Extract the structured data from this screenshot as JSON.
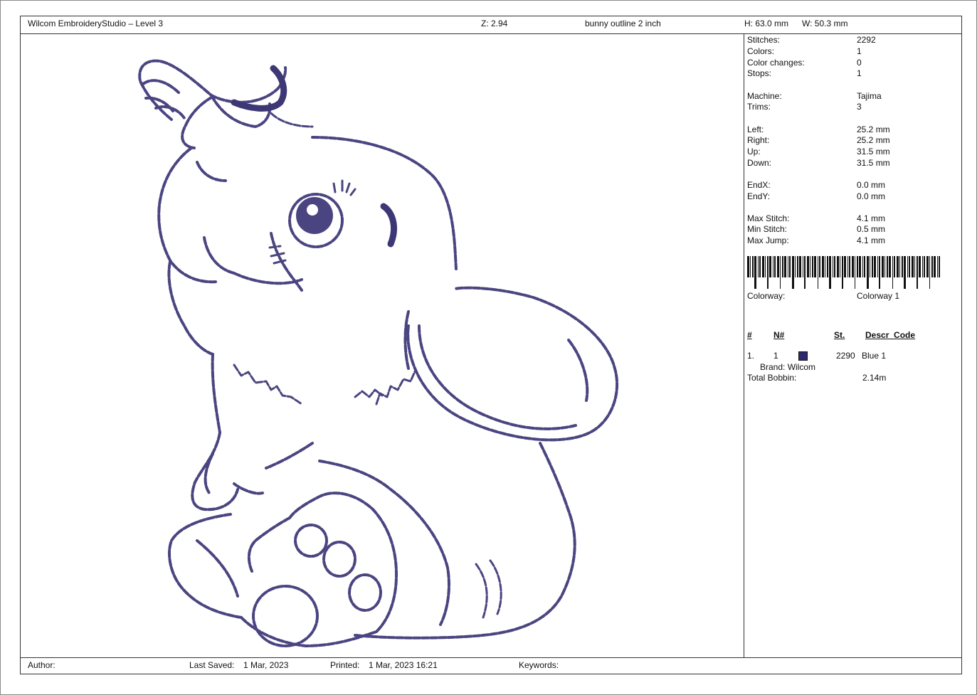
{
  "header": {
    "app": "Wilcom EmbroideryStudio – Level 3",
    "zoom": "Z: 2.94",
    "design_name": "bunny outline 2 inch",
    "height": "H: 63.0 mm",
    "width": "W: 50.3 mm"
  },
  "stats": [
    {
      "label": "Stitches:",
      "value": "2292"
    },
    {
      "label": "Colors:",
      "value": "1"
    },
    {
      "label": "Color changes:",
      "value": "0"
    },
    {
      "label": "Stops:",
      "value": "1"
    },
    {
      "label": "Machine:",
      "value": "Tajima"
    },
    {
      "label": "Trims:",
      "value": "3"
    },
    {
      "label": "Left:",
      "value": "25.2 mm"
    },
    {
      "label": "Right:",
      "value": "25.2 mm"
    },
    {
      "label": "Up:",
      "value": "31.5 mm"
    },
    {
      "label": "Down:",
      "value": "31.5 mm"
    },
    {
      "label": "EndX:",
      "value": "0.0 mm"
    },
    {
      "label": "EndY:",
      "value": "0.0 mm"
    },
    {
      "label": "Max Stitch:",
      "value": "4.1 mm"
    },
    {
      "label": "Min Stitch:",
      "value": "0.5 mm"
    },
    {
      "label": "Max Jump:",
      "value": "4.1 mm"
    }
  ],
  "colorway": {
    "label": "Colorway:",
    "value": "Colorway 1"
  },
  "color_table": {
    "headers": {
      "num": "#",
      "needle": "N#",
      "stitches": "St.",
      "descr": "Descr_Code"
    },
    "rows": [
      {
        "num": "1.",
        "needle": "1",
        "color": "#2e2a6e",
        "stitches": "2290",
        "descr": "Blue 1",
        "brand": "Brand: Wilcom"
      }
    ]
  },
  "bobbin": {
    "label": "Total Bobbin:",
    "value": "2.14m"
  },
  "footer": {
    "author": "Author:",
    "last_saved_label": "Last Saved:",
    "last_saved": "1 Mar, 2023",
    "printed_label": "Printed:",
    "printed": "1 Mar, 2023 16:21",
    "keywords": "Keywords:"
  },
  "colors": {
    "thread": "#4a4580",
    "border": "#333333"
  }
}
